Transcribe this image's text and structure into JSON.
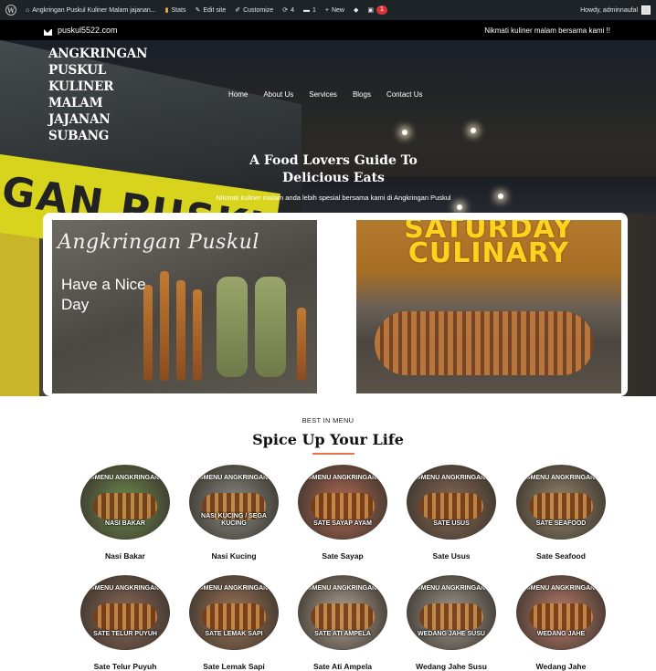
{
  "adminbar": {
    "site_name": "Angkringan Puskul Kuliner Malam jajanan...",
    "stats": "Stats",
    "edit": "Edit site",
    "customize": "Customize",
    "updates": "4",
    "comments": "1",
    "new": "New",
    "notif_count": "1",
    "howdy": "Howdy, adminnaufal"
  },
  "topbar": {
    "email": "puskul5522.com",
    "tagline": "Nikmati kuliner malam bersama kami !!"
  },
  "brand": {
    "lines": [
      "ANGKRINGAN",
      "PUSKUL",
      "KULINER",
      "MALAM",
      "JAJANAN",
      "SUBANG"
    ]
  },
  "nav": [
    "Home",
    "About Us",
    "Services",
    "Blogs",
    "Contact Us"
  ],
  "hero": {
    "headline_1": "A Food Lovers Guide To",
    "headline_2": "Delicious Eats",
    "subline": "Nikmati kuliner malam anda lebih spesial bersama kami di Angkringan Puskul",
    "banner_text": "GAN PUSKUL"
  },
  "promo": {
    "left_script": "Angkringan Puskul",
    "left_line1": "Have a Nice",
    "left_line2": "Day",
    "right_line1": "SATURDAY",
    "right_line2": "CULINARY"
  },
  "menu": {
    "kicker": "BEST IN MENU",
    "title": "Spice Up Your Life",
    "tag": "#MENU ANGKRINGAN",
    "items": [
      {
        "label": "Nasi Bakar",
        "cap": "NASI BAKAR",
        "color": "#6f8f4e"
      },
      {
        "label": "Nasi Kucing",
        "cap": "NASI KUCING / SEGA KUCING",
        "color": "#8a8d86"
      },
      {
        "label": "Sate Sayap",
        "cap": "SATE SAYAP AYAM",
        "color": "#b86b55"
      },
      {
        "label": "Sate Usus",
        "cap": "SATE USUS",
        "color": "#8b6a55"
      },
      {
        "label": "Sate Seafood",
        "cap": "SATE SEAFOOD",
        "color": "#9a8a6e"
      },
      {
        "label": "Sate Telur Puyuh",
        "cap": "SATE TELUR PUYUH",
        "color": "#8f6a58"
      },
      {
        "label": "Sate Lemak Sapi",
        "cap": "SATE LEMAK SAPI",
        "color": "#a3785a"
      },
      {
        "label": "Sate Ati Ampela",
        "cap": "SATE ATI AMPELA",
        "color": "#b8a89a"
      },
      {
        "label": "Wedang Jahe Susu",
        "cap": "WEDANG JAHE SUSU",
        "color": "#a49d94"
      },
      {
        "label": "Wedang Jahe",
        "cap": "WEDANG JAHE",
        "color": "#c27f6e"
      }
    ]
  }
}
